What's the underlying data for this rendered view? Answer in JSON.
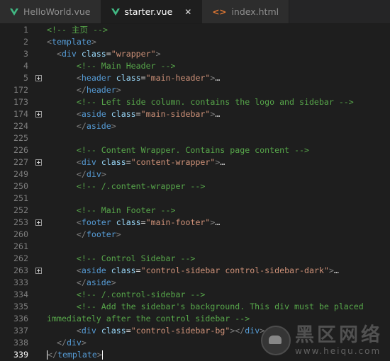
{
  "tabs": [
    {
      "label": "HelloWorld.vue",
      "icon": "vue-icon",
      "active": false
    },
    {
      "label": "starter.vue",
      "icon": "vue-icon",
      "active": true
    },
    {
      "label": "index.html",
      "icon": "html-icon",
      "active": false
    }
  ],
  "colors": {
    "vue": "#41b883",
    "html": "#e37933",
    "comment": "#57a64a",
    "tag": "#569cd6",
    "string": "#ce9178"
  },
  "lines": [
    {
      "n": "1",
      "indent": "",
      "fold": false,
      "text": "<!-- 主页 -->",
      "kind": "comment"
    },
    {
      "n": "2",
      "indent": "",
      "fold": false,
      "text": "<template>",
      "kind": "tag"
    },
    {
      "n": "3",
      "indent": "  ",
      "fold": false,
      "text": "<div class=\"wrapper\">",
      "kind": "tag"
    },
    {
      "n": "4",
      "indent": "      ",
      "fold": false,
      "text": "<!-- Main Header -->",
      "kind": "comment"
    },
    {
      "n": "5",
      "indent": "      ",
      "fold": true,
      "text": "<header class=\"main-header\">…",
      "kind": "tag"
    },
    {
      "n": "172",
      "indent": "      ",
      "fold": false,
      "text": "</header>",
      "kind": "tag"
    },
    {
      "n": "173",
      "indent": "      ",
      "fold": false,
      "text": "<!-- Left side column. contains the logo and sidebar -->",
      "kind": "comment"
    },
    {
      "n": "174",
      "indent": "      ",
      "fold": true,
      "text": "<aside class=\"main-sidebar\">…",
      "kind": "tag"
    },
    {
      "n": "224",
      "indent": "      ",
      "fold": false,
      "text": "</aside>",
      "kind": "tag"
    },
    {
      "n": "225",
      "indent": "",
      "fold": false,
      "text": "",
      "kind": "empty"
    },
    {
      "n": "226",
      "indent": "      ",
      "fold": false,
      "text": "<!-- Content Wrapper. Contains page content -->",
      "kind": "comment"
    },
    {
      "n": "227",
      "indent": "      ",
      "fold": true,
      "text": "<div class=\"content-wrapper\">…",
      "kind": "tag"
    },
    {
      "n": "249",
      "indent": "      ",
      "fold": false,
      "text": "</div>",
      "kind": "tag"
    },
    {
      "n": "250",
      "indent": "      ",
      "fold": false,
      "text": "<!-- /.content-wrapper -->",
      "kind": "comment"
    },
    {
      "n": "251",
      "indent": "",
      "fold": false,
      "text": "",
      "kind": "empty"
    },
    {
      "n": "252",
      "indent": "      ",
      "fold": false,
      "text": "<!-- Main Footer -->",
      "kind": "comment"
    },
    {
      "n": "253",
      "indent": "      ",
      "fold": true,
      "text": "<footer class=\"main-footer\">…",
      "kind": "tag"
    },
    {
      "n": "260",
      "indent": "      ",
      "fold": false,
      "text": "</footer>",
      "kind": "tag"
    },
    {
      "n": "261",
      "indent": "",
      "fold": false,
      "text": "",
      "kind": "empty"
    },
    {
      "n": "262",
      "indent": "      ",
      "fold": false,
      "text": "<!-- Control Sidebar -->",
      "kind": "comment"
    },
    {
      "n": "263",
      "indent": "      ",
      "fold": true,
      "text": "<aside class=\"control-sidebar control-sidebar-dark\">…",
      "kind": "tag"
    },
    {
      "n": "333",
      "indent": "      ",
      "fold": false,
      "text": "</aside>",
      "kind": "tag"
    },
    {
      "n": "334",
      "indent": "      ",
      "fold": false,
      "text": "<!-- /.control-sidebar -->",
      "kind": "comment"
    },
    {
      "n": "335",
      "indent": "      ",
      "fold": false,
      "text": "<!-- Add the sidebar's background. This div must be placed",
      "kind": "comment"
    },
    {
      "n": "336",
      "indent": "",
      "fold": false,
      "text": "immediately after the control sidebar -->",
      "kind": "comment"
    },
    {
      "n": "337",
      "indent": "      ",
      "fold": false,
      "text": "<div class=\"control-sidebar-bg\"></div>",
      "kind": "tag"
    },
    {
      "n": "338",
      "indent": "  ",
      "fold": false,
      "text": "</div>",
      "kind": "tag"
    },
    {
      "n": "339",
      "indent": "",
      "fold": false,
      "text": "</template>",
      "kind": "tag",
      "current": true
    }
  ],
  "watermark": {
    "cn": "黑区网络",
    "url": "www.heiqu.com"
  }
}
